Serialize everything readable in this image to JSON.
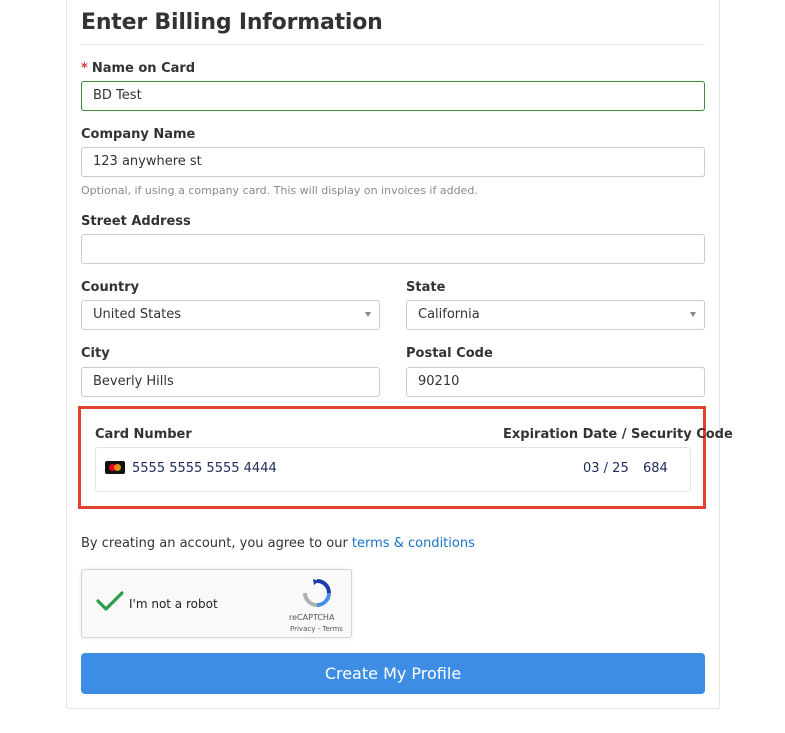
{
  "form": {
    "title": "Enter Billing Information",
    "name_on_card": {
      "required_mark": "*",
      "label": "Name on Card",
      "value": "BD Test"
    },
    "company_name": {
      "label": "Company Name",
      "value": "123 anywhere st",
      "help": "Optional, if using a company card. This will display on invoices if added."
    },
    "street_address": {
      "label": "Street Address",
      "value": ""
    },
    "country": {
      "label": "Country",
      "value": "United States"
    },
    "state": {
      "label": "State",
      "value": "California"
    },
    "city": {
      "label": "City",
      "value": "Beverly Hills"
    },
    "postal_code": {
      "label": "Postal Code",
      "value": "90210"
    },
    "card": {
      "number_label": "Card Number",
      "exp_label": "Expiration Date / Security Code",
      "number": "5555 5555 5555 4444",
      "expiration": "03 / 25",
      "cvc": "684",
      "brand_icon": "mastercard-icon",
      "highlight_color": "#e2412f"
    },
    "terms": {
      "prefix": "By creating an account, you agree to our ",
      "link": "terms & conditions"
    },
    "captcha": {
      "label": "I'm not a robot",
      "brand": "reCAPTCHA",
      "links": "Privacy - Terms",
      "checked": true
    },
    "submit_label": "Create My Profile",
    "accent_color": "#3d8de4"
  }
}
